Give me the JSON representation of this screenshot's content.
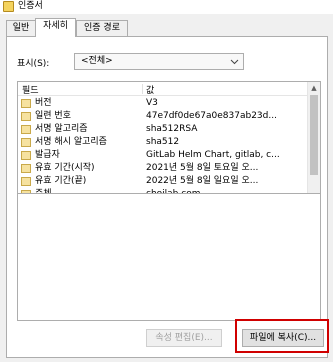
{
  "window": {
    "title": "인증서"
  },
  "tabs": [
    {
      "label": "일반"
    },
    {
      "label": "자세히"
    },
    {
      "label": "인증 경로"
    }
  ],
  "show": {
    "label": "표시(S):",
    "selected": "<전체>"
  },
  "list": {
    "col_field": "필드",
    "col_value": "값",
    "rows": [
      {
        "field": "버전",
        "value": "V3"
      },
      {
        "field": "일련 번호",
        "value": "47e7df0de67a0e837ab23d..."
      },
      {
        "field": "서명 알고리즘",
        "value": "sha512RSA"
      },
      {
        "field": "서명 해시 알고리즘",
        "value": "sha512"
      },
      {
        "field": "발급자",
        "value": "GitLab Helm Chart, gitlab, c..."
      },
      {
        "field": "유효 기간(시작)",
        "value": "2021년 5월 8일 토요일 오..."
      },
      {
        "field": "유효 기간(끝)",
        "value": "2022년 5월 8일 일요일 오..."
      },
      {
        "field": "주체",
        "value": "choilab.com"
      }
    ]
  },
  "buttons": {
    "edit_props": "속성 편집(E)...",
    "copy_to_file": "파일에 복사(C)..."
  },
  "colors": {
    "highlight": "#d00000"
  }
}
